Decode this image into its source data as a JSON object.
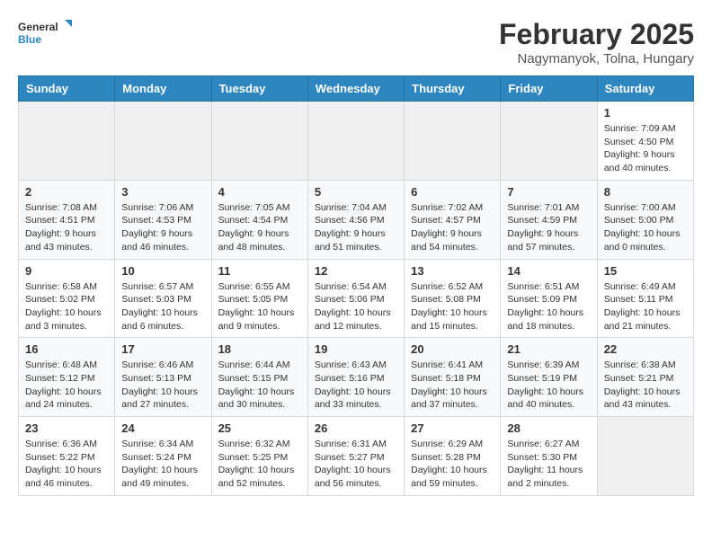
{
  "logo": {
    "general": "General",
    "blue": "Blue"
  },
  "title": {
    "month": "February 2025",
    "location": "Nagymanyok, Tolna, Hungary"
  },
  "weekdays": [
    "Sunday",
    "Monday",
    "Tuesday",
    "Wednesday",
    "Thursday",
    "Friday",
    "Saturday"
  ],
  "weeks": [
    [
      {
        "day": "",
        "info": ""
      },
      {
        "day": "",
        "info": ""
      },
      {
        "day": "",
        "info": ""
      },
      {
        "day": "",
        "info": ""
      },
      {
        "day": "",
        "info": ""
      },
      {
        "day": "",
        "info": ""
      },
      {
        "day": "1",
        "info": "Sunrise: 7:09 AM\nSunset: 4:50 PM\nDaylight: 9 hours and 40 minutes."
      }
    ],
    [
      {
        "day": "2",
        "info": "Sunrise: 7:08 AM\nSunset: 4:51 PM\nDaylight: 9 hours and 43 minutes."
      },
      {
        "day": "3",
        "info": "Sunrise: 7:06 AM\nSunset: 4:53 PM\nDaylight: 9 hours and 46 minutes."
      },
      {
        "day": "4",
        "info": "Sunrise: 7:05 AM\nSunset: 4:54 PM\nDaylight: 9 hours and 48 minutes."
      },
      {
        "day": "5",
        "info": "Sunrise: 7:04 AM\nSunset: 4:56 PM\nDaylight: 9 hours and 51 minutes."
      },
      {
        "day": "6",
        "info": "Sunrise: 7:02 AM\nSunset: 4:57 PM\nDaylight: 9 hours and 54 minutes."
      },
      {
        "day": "7",
        "info": "Sunrise: 7:01 AM\nSunset: 4:59 PM\nDaylight: 9 hours and 57 minutes."
      },
      {
        "day": "8",
        "info": "Sunrise: 7:00 AM\nSunset: 5:00 PM\nDaylight: 10 hours and 0 minutes."
      }
    ],
    [
      {
        "day": "9",
        "info": "Sunrise: 6:58 AM\nSunset: 5:02 PM\nDaylight: 10 hours and 3 minutes."
      },
      {
        "day": "10",
        "info": "Sunrise: 6:57 AM\nSunset: 5:03 PM\nDaylight: 10 hours and 6 minutes."
      },
      {
        "day": "11",
        "info": "Sunrise: 6:55 AM\nSunset: 5:05 PM\nDaylight: 10 hours and 9 minutes."
      },
      {
        "day": "12",
        "info": "Sunrise: 6:54 AM\nSunset: 5:06 PM\nDaylight: 10 hours and 12 minutes."
      },
      {
        "day": "13",
        "info": "Sunrise: 6:52 AM\nSunset: 5:08 PM\nDaylight: 10 hours and 15 minutes."
      },
      {
        "day": "14",
        "info": "Sunrise: 6:51 AM\nSunset: 5:09 PM\nDaylight: 10 hours and 18 minutes."
      },
      {
        "day": "15",
        "info": "Sunrise: 6:49 AM\nSunset: 5:11 PM\nDaylight: 10 hours and 21 minutes."
      }
    ],
    [
      {
        "day": "16",
        "info": "Sunrise: 6:48 AM\nSunset: 5:12 PM\nDaylight: 10 hours and 24 minutes."
      },
      {
        "day": "17",
        "info": "Sunrise: 6:46 AM\nSunset: 5:13 PM\nDaylight: 10 hours and 27 minutes."
      },
      {
        "day": "18",
        "info": "Sunrise: 6:44 AM\nSunset: 5:15 PM\nDaylight: 10 hours and 30 minutes."
      },
      {
        "day": "19",
        "info": "Sunrise: 6:43 AM\nSunset: 5:16 PM\nDaylight: 10 hours and 33 minutes."
      },
      {
        "day": "20",
        "info": "Sunrise: 6:41 AM\nSunset: 5:18 PM\nDaylight: 10 hours and 37 minutes."
      },
      {
        "day": "21",
        "info": "Sunrise: 6:39 AM\nSunset: 5:19 PM\nDaylight: 10 hours and 40 minutes."
      },
      {
        "day": "22",
        "info": "Sunrise: 6:38 AM\nSunset: 5:21 PM\nDaylight: 10 hours and 43 minutes."
      }
    ],
    [
      {
        "day": "23",
        "info": "Sunrise: 6:36 AM\nSunset: 5:22 PM\nDaylight: 10 hours and 46 minutes."
      },
      {
        "day": "24",
        "info": "Sunrise: 6:34 AM\nSunset: 5:24 PM\nDaylight: 10 hours and 49 minutes."
      },
      {
        "day": "25",
        "info": "Sunrise: 6:32 AM\nSunset: 5:25 PM\nDaylight: 10 hours and 52 minutes."
      },
      {
        "day": "26",
        "info": "Sunrise: 6:31 AM\nSunset: 5:27 PM\nDaylight: 10 hours and 56 minutes."
      },
      {
        "day": "27",
        "info": "Sunrise: 6:29 AM\nSunset: 5:28 PM\nDaylight: 10 hours and 59 minutes."
      },
      {
        "day": "28",
        "info": "Sunrise: 6:27 AM\nSunset: 5:30 PM\nDaylight: 11 hours and 2 minutes."
      },
      {
        "day": "",
        "info": ""
      }
    ]
  ]
}
